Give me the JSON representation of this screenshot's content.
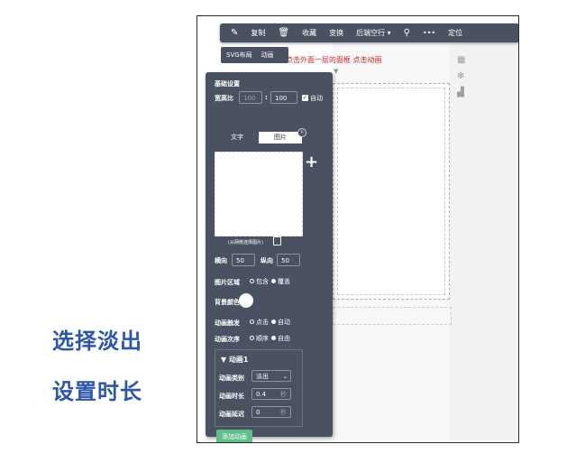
{
  "toolbar": {
    "items": [
      "复制",
      "收藏",
      "变换",
      "后端空行",
      "定位"
    ],
    "icons": [
      "pin-icon",
      "trash-icon",
      "dropdown-icon",
      "link-off-icon",
      "more-icon"
    ],
    "more": "•••"
  },
  "subbar": {
    "items": [
      "SVG布局",
      "动画"
    ]
  },
  "hint": "点击外面一层的面框 点击动画",
  "panel": {
    "title": "基础设置",
    "ratio_label": "宽高比",
    "ratio_w": "100",
    "ratio_sep": ":",
    "ratio_h": "100",
    "auto_label": "自动",
    "tab_text": "文字",
    "tab_image": "图片",
    "image_caption": "(从网络选择图片)",
    "h_label": "横向",
    "h_value": "50",
    "v_label": "纵向",
    "v_value": "50",
    "area_label": "图片区域",
    "area_opt1": "包含",
    "area_opt2": "覆盖",
    "bg_label": "背景颜色",
    "trigger_label": "动画触发",
    "trigger_opt1": "点击",
    "trigger_opt2": "自动",
    "order_label": "动画次序",
    "order_opt1": "顺序",
    "order_opt2": "自由",
    "anim_title": "▼ 动画1",
    "type_label": "动画类别",
    "type_value": "淡出",
    "duration_label": "动画时长",
    "duration_value": "0.4",
    "delay_label": "动画延迟",
    "delay_value": "0",
    "unit": "秒",
    "add_button": "添加动画"
  },
  "captions": {
    "line1": "选择淡出",
    "line2": "设置时长"
  },
  "colors": {
    "panel": "#4a5262",
    "accent": "#5fbf8a",
    "caption": "#2a55b0",
    "hint": "#d42020"
  }
}
